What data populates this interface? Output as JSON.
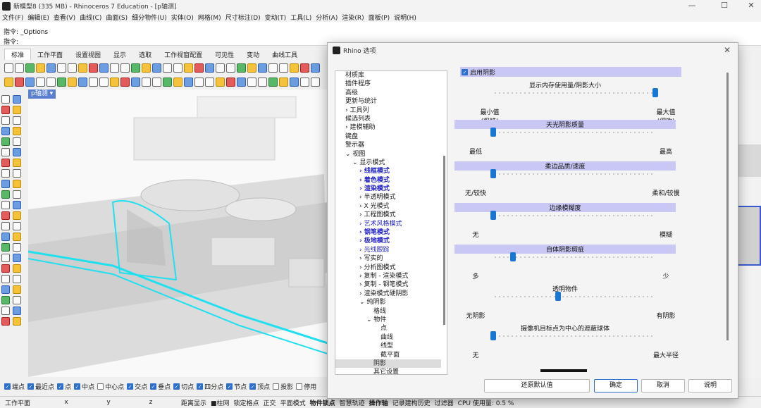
{
  "window": {
    "title": "新模型8 (335 MB) - Rhinoceros 7 Education - [p轴测]",
    "minimize": "—",
    "maximize": "☐",
    "close": "✕"
  },
  "menu": [
    "文件(F)",
    "编辑(E)",
    "查看(V)",
    "曲线(C)",
    "曲面(S)",
    "细分物件(U)",
    "实体(O)",
    "网格(M)",
    "尺寸标注(D)",
    "变动(T)",
    "工具(L)",
    "分析(A)",
    "渲染(R)",
    "面板(P)",
    "说明(H)"
  ],
  "command": {
    "history": "指令: _Options",
    "prompt": "指令:"
  },
  "tabs": [
    "标准",
    "工作平面",
    "设置视图",
    "显示",
    "选取",
    "工作视窗配置",
    "可见性",
    "变动",
    "曲线工具"
  ],
  "viewport": {
    "label": "p轴测 ▾"
  },
  "osnaps": [
    {
      "label": "端点",
      "checked": true
    },
    {
      "label": "最近点",
      "checked": true
    },
    {
      "label": "点",
      "checked": true
    },
    {
      "label": "中点",
      "checked": true
    },
    {
      "label": "中心点",
      "checked": false
    },
    {
      "label": "交点",
      "checked": true
    },
    {
      "label": "垂点",
      "checked": true
    },
    {
      "label": "切点",
      "checked": true
    },
    {
      "label": "四分点",
      "checked": true
    },
    {
      "label": "节点",
      "checked": true
    },
    {
      "label": "顶点",
      "checked": true
    },
    {
      "label": "投影",
      "checked": false
    },
    {
      "label": "停用",
      "checked": false
    }
  ],
  "statusbar": {
    "items": [
      "工作平面",
      "x",
      "y",
      "z",
      "距离显示",
      "■柱网",
      "锁定格点",
      "正交",
      "平面模式",
      "物件锁点",
      "智慧轨迹",
      "操作轴",
      "记录建构历史",
      "过滤器",
      "CPU 使用量: 0.5 %"
    ],
    "bold": [
      "物件锁点",
      "操作轴"
    ]
  },
  "dialog": {
    "title": "Rhino 选项",
    "close": "✕",
    "tree": [
      {
        "label": "材质库",
        "indent": 0
      },
      {
        "label": "插件程序",
        "indent": 0
      },
      {
        "label": "高级",
        "indent": 0
      },
      {
        "label": "更新与统计",
        "indent": 0
      },
      {
        "label": "›  工具列",
        "indent": 0
      },
      {
        "label": "候选列表",
        "indent": 0
      },
      {
        "label": "›  建模辅助",
        "indent": 0
      },
      {
        "label": "键盘",
        "indent": 0
      },
      {
        "label": "警示器",
        "indent": 0
      },
      {
        "label": "⌄  视图",
        "indent": 0
      },
      {
        "label": "⌄  显示模式",
        "indent": 1
      },
      {
        "label": "›  线框模式",
        "indent": 2,
        "style": "blue bold"
      },
      {
        "label": "›  着色模式",
        "indent": 2,
        "style": "blue bold"
      },
      {
        "label": "›  渲染模式",
        "indent": 2,
        "style": "blue bold"
      },
      {
        "label": "›  半透明模式",
        "indent": 2
      },
      {
        "label": "›  X 光模式",
        "indent": 2
      },
      {
        "label": "›  工程图模式",
        "indent": 2
      },
      {
        "label": "›  艺术风格模式",
        "indent": 2,
        "style": "blue"
      },
      {
        "label": "›  钢笔模式",
        "indent": 2,
        "style": "blue bold"
      },
      {
        "label": "›  极地模式",
        "indent": 2,
        "style": "blue bold"
      },
      {
        "label": "›  光线跟踪",
        "indent": 2,
        "style": "blue"
      },
      {
        "label": "›  写实的",
        "indent": 2
      },
      {
        "label": "›  分析图模式",
        "indent": 2
      },
      {
        "label": "›  复制 - 渲染模式",
        "indent": 2
      },
      {
        "label": "›  复制 - 钢笔模式",
        "indent": 2
      },
      {
        "label": "›  渲染模式硬阴影",
        "indent": 2
      },
      {
        "label": "⌄  纯阴影",
        "indent": 2
      },
      {
        "label": "格线",
        "indent": 4
      },
      {
        "label": "⌄  物件",
        "indent": 3
      },
      {
        "label": "点",
        "indent": 5
      },
      {
        "label": "曲线",
        "indent": 5
      },
      {
        "label": "线型",
        "indent": 5
      },
      {
        "label": "截平面",
        "indent": 5
      },
      {
        "label": "阴影",
        "indent": 4,
        "style": "sel"
      },
      {
        "label": "其它设置",
        "indent": 4
      }
    ],
    "enable_shadows": {
      "label": "启用阴影",
      "checked": true
    },
    "sliders": [
      {
        "title": "显示内存使用量/阴影大小",
        "highlight": false,
        "value": 1.0,
        "min_label": "最小值\n(粗糙)",
        "max_label": "最大值\n(细致)"
      },
      {
        "title": "天光阴影质量",
        "highlight": true,
        "value": 0.0,
        "min_label": "最低",
        "max_label": "最高"
      },
      {
        "title": "柔边品质/速度",
        "highlight": true,
        "value": 0.0,
        "min_label": "无/较快",
        "max_label": "柔和/较慢"
      },
      {
        "title": "边缘模糊度",
        "highlight": true,
        "value": 0.0,
        "min_label": "无",
        "max_label": "模糊"
      },
      {
        "title": "自体阴影瑕疵",
        "highlight": true,
        "value": 0.12,
        "min_label": "多",
        "max_label": "少"
      },
      {
        "title": "透明物件",
        "highlight": false,
        "value": 0.4,
        "min_label": "无阴影",
        "max_label": "有阴影"
      },
      {
        "title": "摄像机目标点为中心的遮蔽球体",
        "highlight": false,
        "value": 0.0,
        "min_label": "无",
        "max_label": "最大半径"
      }
    ],
    "buttons": {
      "restore": "还原默认值",
      "ok": "确定",
      "cancel": "取消",
      "help": "说明"
    }
  }
}
